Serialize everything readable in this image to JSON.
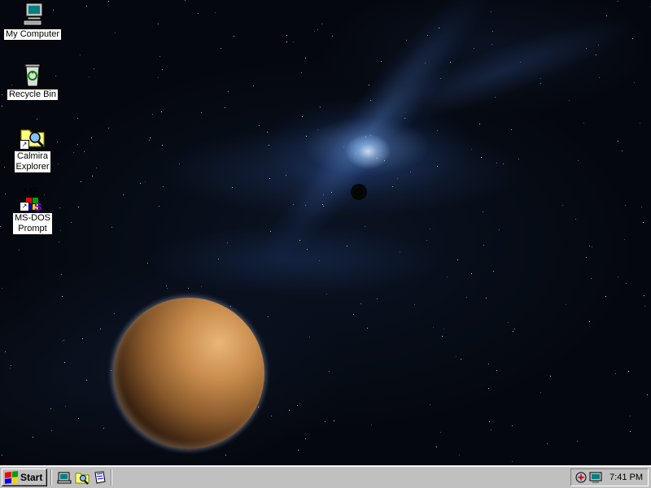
{
  "desktop": {
    "icons": [
      {
        "label": "My Computer",
        "icon": "computer-icon"
      },
      {
        "label": "Recycle Bin",
        "icon": "recycle-bin-icon"
      },
      {
        "label": "Calmira\nExplorer",
        "icon": "explorer-shortcut-icon"
      },
      {
        "label": "MS-DOS\nPrompt",
        "icon": "ms-dos-shortcut-icon"
      }
    ],
    "wallpaper": "space-planet-wallpaper",
    "colors": {
      "icon_label_bg": "#ffffff",
      "taskbar": "#c0c0c0"
    }
  },
  "taskbar": {
    "start_label": "Start",
    "quick_launch": [
      {
        "icon": "show-desktop-icon"
      },
      {
        "icon": "explorer-icon"
      },
      {
        "icon": "help-icon"
      }
    ],
    "tray": {
      "icons": [
        {
          "icon": "network-icon"
        },
        {
          "icon": "display-icon"
        }
      ],
      "clock": "7:41 PM"
    }
  }
}
